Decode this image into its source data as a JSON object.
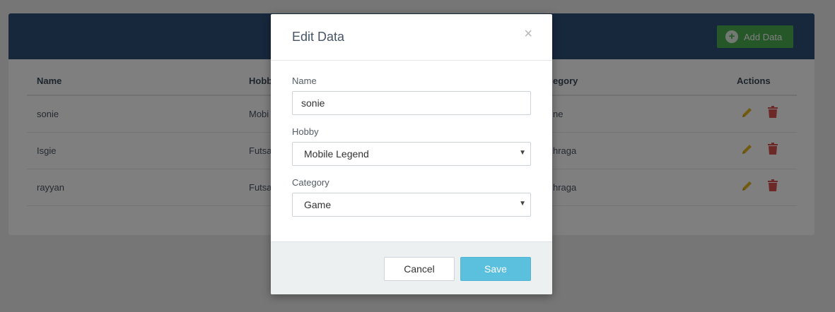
{
  "header": {
    "add_button_label": "Add Data",
    "add_icon": "plus-circle-icon"
  },
  "table": {
    "columns": {
      "name": "Name",
      "hobby": "Hobb",
      "category": "egory",
      "actions": "Actions"
    },
    "rows": [
      {
        "name": "sonie",
        "hobby": "Mobi",
        "category": "ne"
      },
      {
        "name": "Isgie",
        "hobby": "Futsa",
        "category": "hraga"
      },
      {
        "name": "rayyan",
        "hobby": "Futsa",
        "category": "hraga"
      }
    ],
    "edit_icon": "pencil-icon",
    "delete_icon": "trash-icon"
  },
  "modal": {
    "title": "Edit Data",
    "close_glyph": "×",
    "name_label": "Name",
    "name_value": "sonie",
    "hobby_label": "Hobby",
    "hobby_value": "Mobile Legend",
    "category_label": "Category",
    "category_value": "Game",
    "caret": "▼",
    "cancel_label": "Cancel",
    "save_label": "Save"
  },
  "colors": {
    "header_bg": "#2f4f78",
    "add_button": "#4caf50",
    "edit_icon": "#e6b422",
    "delete_icon": "#d9534f",
    "save_button": "#5bc0de"
  }
}
